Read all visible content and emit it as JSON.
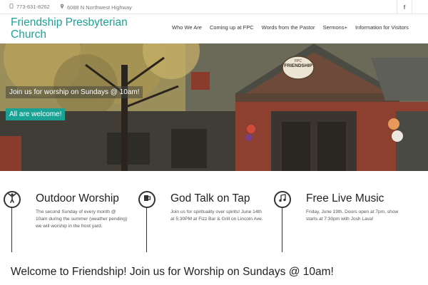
{
  "topbar": {
    "phone": "773-631-8262",
    "address": "6088 N Northwest Highway",
    "social": "f"
  },
  "header": {
    "logo_line1": "Friendship Presbyterian",
    "logo_line2": "Church"
  },
  "nav": {
    "items": [
      {
        "label": "Who We Are"
      },
      {
        "label": "Coming up at FPC"
      },
      {
        "label": "Words from the Pastor"
      },
      {
        "label": "Sermons+"
      },
      {
        "label": "Information for Visitors"
      }
    ]
  },
  "hero": {
    "caption1": "Join us for worship on Sundays @ 10am!",
    "caption2": "All are welcome!",
    "sign_text": "FRIENDSHIP",
    "sign_small": "FPC"
  },
  "features": [
    {
      "icon": "person-arms-raised-icon",
      "title": "Outdoor Worship",
      "text": "The second Sunday of every month @ 10am during the summer (weather pending) we will worship in the front yard."
    },
    {
      "icon": "beer-mug-icon",
      "title": "God Talk on Tap",
      "text": "Join us for spirituality over spirits! June 14th at 5:30PM at Fizz Bar & Grill on Lincoln Ave."
    },
    {
      "icon": "music-note-icon",
      "title": "Free Live Music",
      "text": "Friday, June 19th. Doors open at 7pm, show starts at 7:30pm with Josh Lava!"
    }
  ],
  "welcome": "Welcome to Friendship! Join us for Worship on Sundays @ 10am!",
  "colors": {
    "accent": "#1aa394",
    "text": "#333333"
  }
}
